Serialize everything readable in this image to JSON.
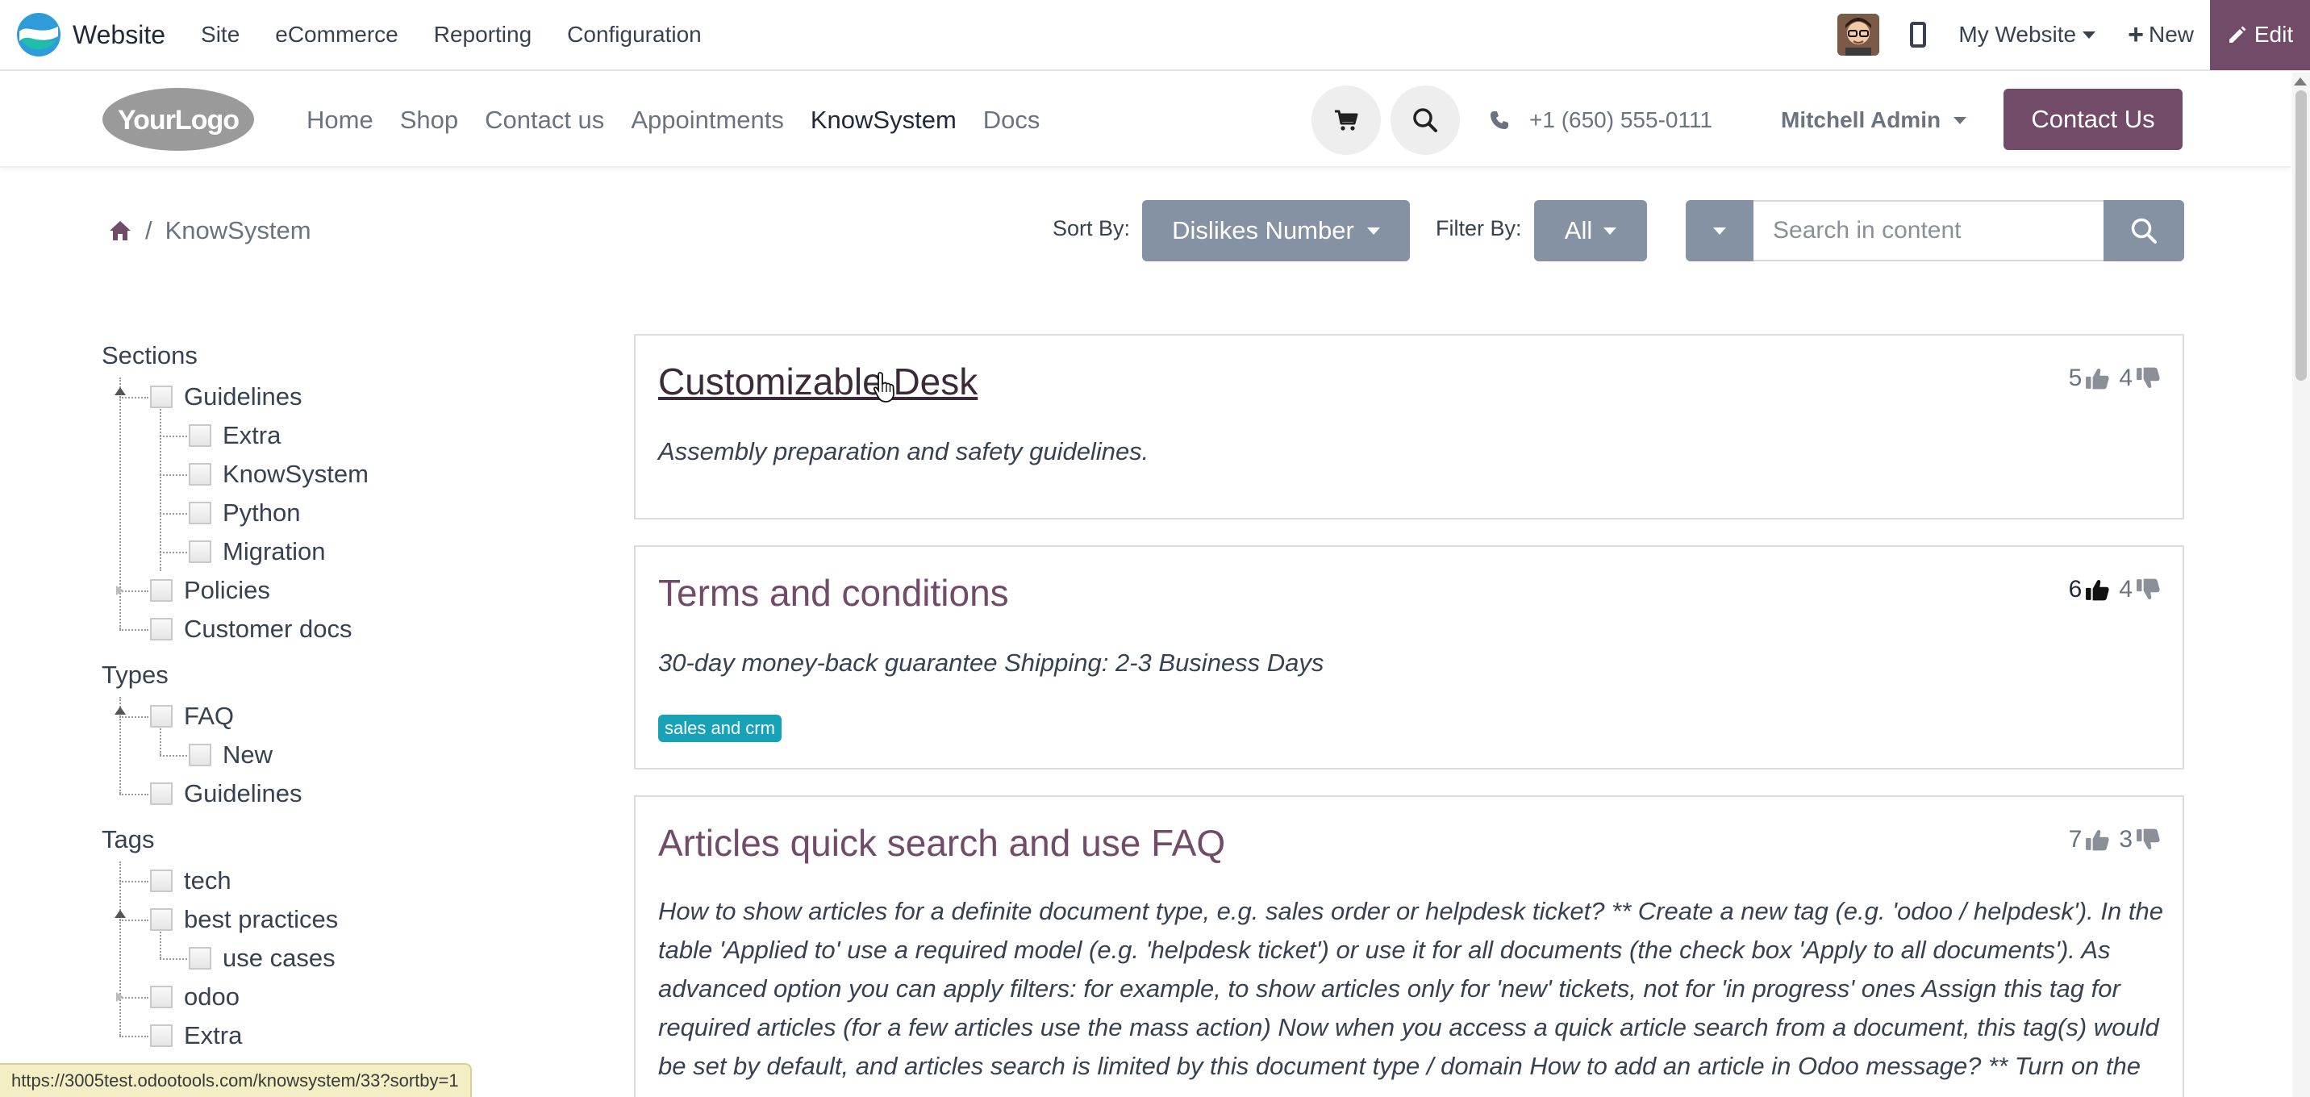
{
  "topbar": {
    "app_name": "Website",
    "menu": [
      "Site",
      "eCommerce",
      "Reporting",
      "Configuration"
    ],
    "my_website": "My Website",
    "new_label": "New",
    "edit_label": "Edit"
  },
  "header": {
    "logo_text": "YourLogo",
    "nav": [
      "Home",
      "Shop",
      "Contact us",
      "Appointments",
      "KnowSystem",
      "Docs"
    ],
    "active_nav": "KnowSystem",
    "phone": "+1 (650) 555-0111",
    "user": "Mitchell Admin",
    "contact_button": "Contact Us"
  },
  "breadcrumb": {
    "current": "KnowSystem",
    "separator": "/"
  },
  "toolbar": {
    "sort_label": "Sort By:",
    "sort_value": "Dislikes Number",
    "filter_label": "Filter By:",
    "filter_value": "All",
    "search_placeholder": "Search in content"
  },
  "sidebar": {
    "sections_title": "Sections",
    "sections": {
      "guidelines": "Guidelines",
      "children": [
        "Extra",
        "KnowSystem",
        "Python",
        "Migration"
      ],
      "policies": "Policies",
      "customer_docs": "Customer docs"
    },
    "types_title": "Types",
    "types": {
      "faq": "FAQ",
      "faq_child": "New",
      "guidelines": "Guidelines"
    },
    "tags_title": "Tags",
    "tags": {
      "tech": "tech",
      "best_practices": "best practices",
      "use_cases": "use cases",
      "odoo": "odoo",
      "extra": "Extra"
    }
  },
  "articles": [
    {
      "title": "Customizable Desk",
      "description": "Assembly preparation and safety guidelines.",
      "likes": "5",
      "dislikes": "4"
    },
    {
      "title": "Terms and conditions",
      "description": "30-day money-back guarantee Shipping: 2-3 Business Days",
      "tag": "sales and crm",
      "likes": "6",
      "dislikes": "4"
    },
    {
      "title": "Articles quick search and use FAQ",
      "description": "How to show articles for a definite document type, e.g. sales order or helpdesk ticket? ** Create a new tag (e.g. 'odoo / helpdesk'). In the table 'Applied to' use a required model (e.g. 'helpdesk ticket') or use it for all documents (the check box 'Apply to all documents'). As advanced option you can apply filters: for example, to show articles only for 'new' tickets, not for 'in progress' ones Assign this tag for required articles (for a few articles use the mass action) Now when you access a quick article search from a document, this tag(s) would be set by default, and articles search is limited by this document type / domain How to add an article in Odoo message? ** Turn on the",
      "likes": "7",
      "dislikes": "3"
    }
  ],
  "status_url": "https://3005test.odootools.com/knowsystem/33?sortby=1",
  "colors": {
    "brand": "#714b67",
    "grey_button": "#8592a3",
    "tag": "#17a2b8"
  }
}
